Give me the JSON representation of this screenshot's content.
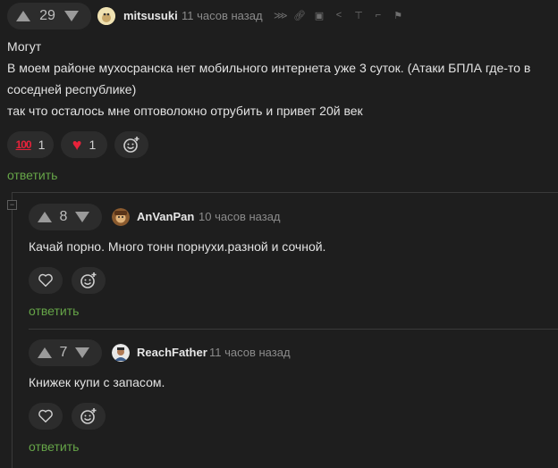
{
  "comments": [
    {
      "rating": "29",
      "author": "mitsusuki",
      "time": "11 часов назад",
      "lines": [
        "Могут",
        "В моем районе мухосранска нет мобильного интернета уже 3 суток. (Атаки БПЛА где-то в",
        "соседней республике)",
        "так что осталось мне оптоволокно отрубить и привет 20й век"
      ],
      "reactions": [
        {
          "icon": "hundred-emoji-icon",
          "count": "1"
        },
        {
          "icon": "heart-icon",
          "count": "1"
        }
      ],
      "reply_label": "ответить"
    },
    {
      "rating": "8",
      "author": "AnVanPan",
      "time": "10 часов назад",
      "lines": [
        "Качай порно. Много тонн порнухи.разной и сочной."
      ],
      "reply_label": "ответить"
    },
    {
      "rating": "7",
      "author": "ReachFather",
      "time": "11 часов назад",
      "lines": [
        "Книжек купи с запасом."
      ],
      "reply_label": "ответить"
    }
  ],
  "toolbar_icons": [
    "subscribe-icon",
    "link-icon",
    "save-icon",
    "share-icon",
    "pin-icon",
    "branch-icon",
    "flag-icon"
  ],
  "colors": {
    "background": "#1e1e1e",
    "reply": "#66a548",
    "heart": "#e8223a",
    "hundred": "#e8223a"
  }
}
